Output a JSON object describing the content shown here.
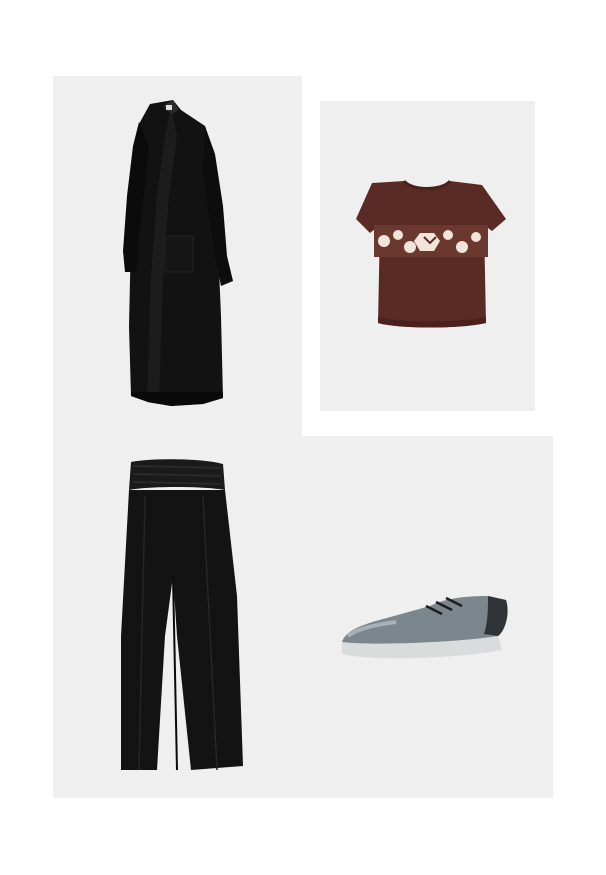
{
  "collage": {
    "background": "#ffffff",
    "panel_background": "#efefef",
    "items": [
      {
        "name": "black-long-cardigan",
        "color": "#111111"
      },
      {
        "name": "brown-cropped-t-shirt",
        "color": "#5a2a24"
      },
      {
        "name": "black-wide-leg-trousers",
        "color": "#131313"
      },
      {
        "name": "grey-metallic-sneaker",
        "color": "#7b878d"
      }
    ]
  }
}
